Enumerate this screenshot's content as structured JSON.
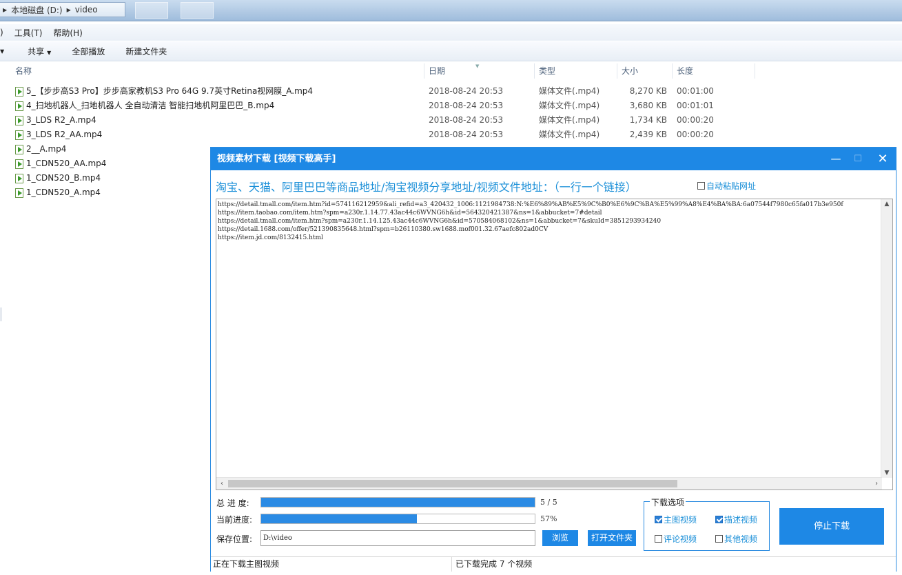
{
  "explorer": {
    "breadcrumb": [
      "本地磁盘 (D:)",
      "video"
    ],
    "menu": [
      ")",
      "工具(T)",
      "帮助(H)"
    ],
    "toolbar": {
      "share": "共享",
      "play_all": "全部播放",
      "new_folder": "新建文件夹"
    },
    "columns": {
      "name": "名称",
      "date": "日期",
      "type": "类型",
      "size": "大小",
      "length": "长度"
    },
    "files": [
      {
        "name": "5_【步步高S3 Pro】步步高家教机S3 Pro 64G 9.7英寸Retina视网膜_A.mp4",
        "date": "2018-08-24 20:53",
        "type": "媒体文件(.mp4)",
        "size": "8,270 KB",
        "length": "00:01:00"
      },
      {
        "name": "4_扫地机器人_扫地机器人 全自动清洁 智能扫地机阿里巴巴_B.mp4",
        "date": "2018-08-24 20:53",
        "type": "媒体文件(.mp4)",
        "size": "3,680 KB",
        "length": "00:01:01"
      },
      {
        "name": "3_LDS R2_A.mp4",
        "date": "2018-08-24 20:53",
        "type": "媒体文件(.mp4)",
        "size": "1,734 KB",
        "length": "00:00:20"
      },
      {
        "name": "3_LDS R2_AA.mp4",
        "date": "2018-08-24 20:53",
        "type": "媒体文件(.mp4)",
        "size": "2,439 KB",
        "length": "00:00:20"
      },
      {
        "name": "2__A.mp4",
        "date": "",
        "type": "",
        "size": "",
        "length": ""
      },
      {
        "name": "1_CDN520_AA.mp4",
        "date": "",
        "type": "",
        "size": "",
        "length": ""
      },
      {
        "name": "1_CDN520_B.mp4",
        "date": "",
        "type": "",
        "size": "",
        "length": ""
      },
      {
        "name": "1_CDN520_A.mp4",
        "date": "",
        "type": "",
        "size": "",
        "length": ""
      }
    ]
  },
  "dialog": {
    "title": "视频素材下载 [视频下载高手]",
    "heading": "淘宝、天猫、阿里巴巴等商品地址/淘宝视频分享地址/视频文件地址：（一行一个链接）",
    "auto_paste_label": "自动粘贴网址",
    "auto_paste_checked": false,
    "urls": [
      "https://detail.tmall.com/item.htm?id=574116212959&ali_refid=a3_420432_1006:1121984738:N:%E6%89%AB%E5%9C%B0%E6%9C%BA%E5%99%A8%E4%BA%BA:6a07544f7980c65fa017b3e950f",
      "https://item.taobao.com/item.htm?spm=a230r.1.14.77.43ac44c6WVNG6h&id=564320421387&ns=1&abbucket=7#detail",
      "https://detail.tmall.com/item.htm?spm=a230r.1.14.125.43ac44c6WVNG6h&id=570584068102&ns=1&abbucket=7&skuId=3851293934240",
      "https://detail.1688.com/offer/521390835648.html?spm=b26110380.sw1688.mof001.32.67aefc802ad0CV",
      "https://item.jd.com/8132415.html"
    ],
    "total_progress": {
      "label": "总 进 度:",
      "done": 5,
      "total": 5,
      "text": "5 / 5",
      "fraction": 1.0
    },
    "current_progress": {
      "label": "当前进度:",
      "text": "57%",
      "fraction": 0.57
    },
    "save_location": {
      "label": "保存位置:",
      "value": "D:\\video"
    },
    "browse_label": "浏览",
    "open_folder_label": "打开文件夹",
    "options": {
      "legend": "下载选项",
      "items": [
        {
          "label": "主图视频",
          "checked": true
        },
        {
          "label": "描述视频",
          "checked": true
        },
        {
          "label": "评论视频",
          "checked": false
        },
        {
          "label": "其他视频",
          "checked": false
        }
      ]
    },
    "stop_label": "停止下载",
    "status_left": "正在下载主图视频",
    "status_right": "已下载完成 7 个视频"
  }
}
